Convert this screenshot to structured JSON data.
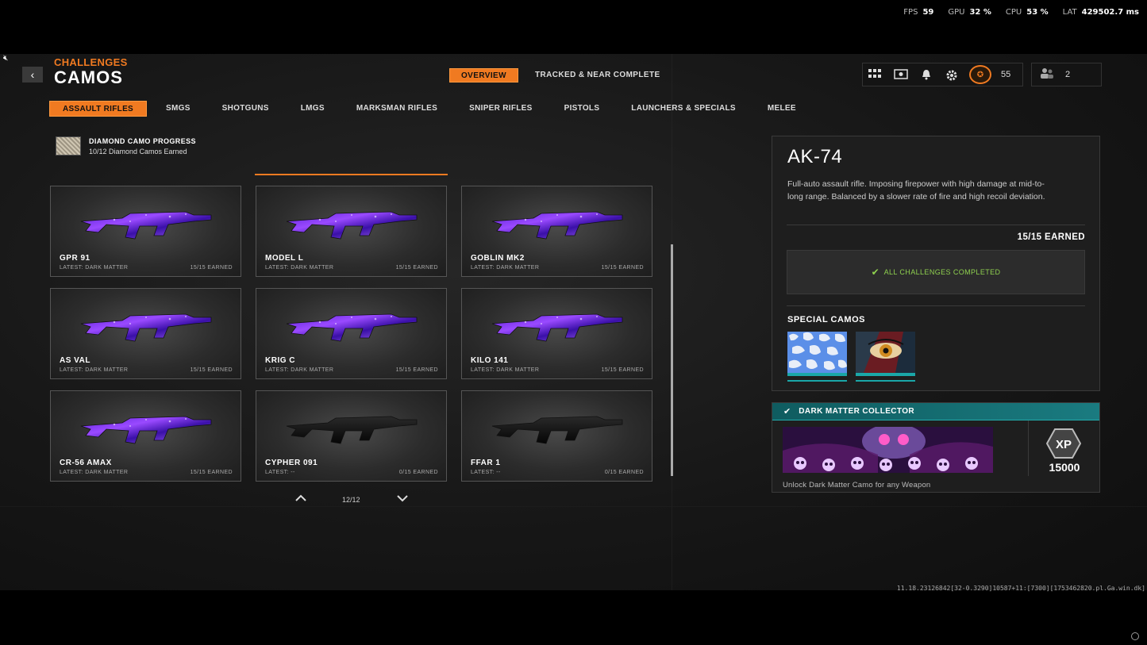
{
  "perf": {
    "fps_label": "FPS",
    "fps": "59",
    "gpu_label": "GPU",
    "gpu": "32 %",
    "cpu_label": "CPU",
    "cpu": "53 %",
    "lat_label": "LAT",
    "lat": "429502.7 ms"
  },
  "header": {
    "back_glyph": "‹",
    "subtitle": "CHALLENGES",
    "title": "CAMOS",
    "tabs": [
      {
        "label": "OVERVIEW",
        "active": true
      },
      {
        "label": "TRACKED & NEAR COMPLETE",
        "active": false
      }
    ],
    "hud": {
      "icons": [
        "grid-icon",
        "ticket-icon",
        "bell-icon",
        "gear-icon"
      ],
      "level": "55",
      "party_count": "2"
    }
  },
  "categories": [
    {
      "label": "ASSAULT RIFLES",
      "active": true
    },
    {
      "label": "SMGS",
      "active": false
    },
    {
      "label": "SHOTGUNS",
      "active": false
    },
    {
      "label": "LMGS",
      "active": false
    },
    {
      "label": "MARKSMAN RIFLES",
      "active": false
    },
    {
      "label": "SNIPER RIFLES",
      "active": false
    },
    {
      "label": "PISTOLS",
      "active": false
    },
    {
      "label": "LAUNCHERS & SPECIALS",
      "active": false
    },
    {
      "label": "MELEE",
      "active": false
    }
  ],
  "diamond": {
    "title": "DIAMOND CAMO PROGRESS",
    "subtitle": "10/12 Diamond Camos Earned"
  },
  "weapons": [
    {
      "name": "GPR 91",
      "latest": "LATEST: DARK MATTER",
      "earned": "15/15 EARNED",
      "camo": "purple"
    },
    {
      "name": "MODEL L",
      "latest": "LATEST: DARK MATTER",
      "earned": "15/15 EARNED",
      "camo": "purple"
    },
    {
      "name": "GOBLIN MK2",
      "latest": "LATEST: DARK MATTER",
      "earned": "15/15 EARNED",
      "camo": "purple"
    },
    {
      "name": "AS VAL",
      "latest": "LATEST: DARK MATTER",
      "earned": "15/15 EARNED",
      "camo": "purple"
    },
    {
      "name": "KRIG C",
      "latest": "LATEST: DARK MATTER",
      "earned": "15/15 EARNED",
      "camo": "purple"
    },
    {
      "name": "KILO 141",
      "latest": "LATEST: DARK MATTER",
      "earned": "15/15 EARNED",
      "camo": "purple"
    },
    {
      "name": "CR-56 AMAX",
      "latest": "LATEST: DARK MATTER",
      "earned": "15/15 EARNED",
      "camo": "purple"
    },
    {
      "name": "CYPHER 091",
      "latest": "LATEST: --",
      "earned": "0/15 EARNED",
      "camo": "black"
    },
    {
      "name": "FFAR 1",
      "latest": "LATEST: --",
      "earned": "0/15 EARNED",
      "camo": "black"
    }
  ],
  "pager": {
    "page": "12/12"
  },
  "detail": {
    "title": "AK-74",
    "description": "Full-auto assault rifle.  Imposing firepower with high damage at mid-to-long range. Balanced by a slower rate of fire and high recoil deviation.",
    "earned": "15/15 EARNED",
    "status": "ALL CHALLENGES COMPLETED",
    "special_label": "SPECIAL CAMOS"
  },
  "collector": {
    "title": "DARK MATTER COLLECTOR",
    "xp": "15000",
    "description": "Unlock Dark Matter Camo for any Weapon"
  },
  "build": "11.18.23126842[32-0.3290]10587+11:[7300][1753462820.pl.Ga.win.dk]",
  "colors": {
    "accent": "#f07a21",
    "teal": "#1a7b80",
    "purple": "#7a3cff",
    "green": "#8fd14f"
  }
}
